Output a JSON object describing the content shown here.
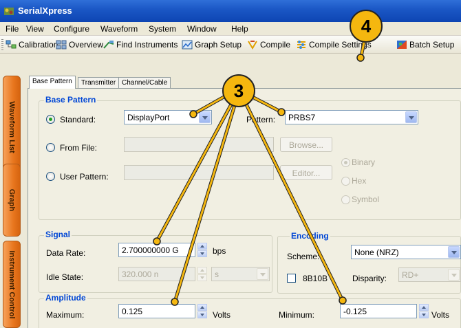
{
  "window": {
    "title": "SerialXpress"
  },
  "menu": [
    "File",
    "View",
    "Configure",
    "Waveform",
    "System",
    "Window",
    "Help"
  ],
  "toolbar": {
    "calibration": "Calibration",
    "overview": "Overview",
    "find_instruments": "Find Instruments",
    "graph_setup": "Graph Setup",
    "compile": "Compile",
    "compile_settings": "Compile Settings",
    "batch_setup": "Batch Setup"
  },
  "side_tabs": [
    "Waveform List",
    "Graph",
    "Instrument Control"
  ],
  "tabs": [
    "Base Pattern",
    "Transmitter",
    "Channel/Cable"
  ],
  "base_pattern": {
    "group_title": "Base Pattern",
    "standard_label": "Standard:",
    "standard_value": "DisplayPort",
    "pattern_label": "Pattern:",
    "pattern_value": "PRBS7",
    "from_file_label": "From File:",
    "browse_label": "Browse...",
    "user_pattern_label": "User Pattern:",
    "editor_label": "Editor...",
    "format_options": [
      "Binary",
      "Hex",
      "Symbol"
    ]
  },
  "signal": {
    "group_title": "Signal",
    "data_rate_label": "Data Rate:",
    "data_rate_value": "2.700000000 G",
    "data_rate_unit": "bps",
    "idle_state_label": "Idle State:",
    "idle_state_value": "320.000 n",
    "idle_state_unit": "s"
  },
  "encoding": {
    "group_title": "Encoding",
    "scheme_label": "Scheme:",
    "scheme_value": "None (NRZ)",
    "option_8b10b": "8B10B",
    "disparity_label": "Disparity:",
    "disparity_value": "RD+"
  },
  "amplitude": {
    "group_title": "Amplitude",
    "maximum_label": "Maximum:",
    "maximum_value": "0.125",
    "minimum_label": "Minimum:",
    "minimum_value": "-0.125",
    "unit": "Volts"
  },
  "callouts": [
    "3",
    "4"
  ],
  "colors": {
    "callout": "#f5b70f",
    "title_bar": "#1a56c4",
    "side_tab": "#e8761e",
    "group_title": "#0046d5"
  }
}
